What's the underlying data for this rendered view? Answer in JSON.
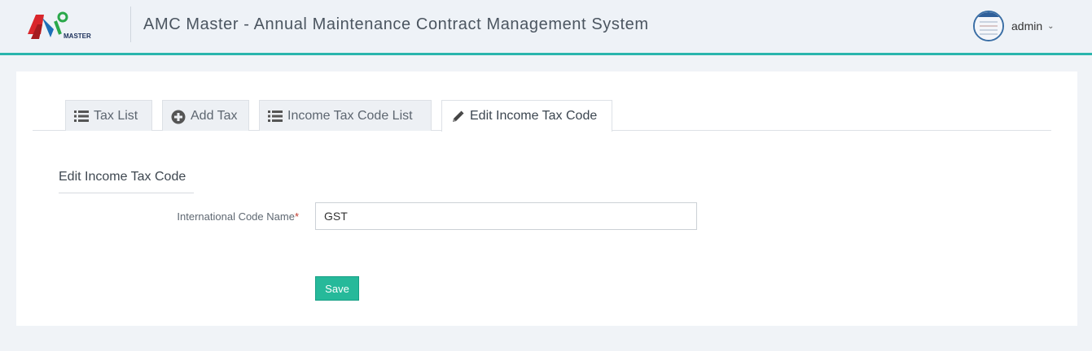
{
  "header": {
    "logo_text": "AMC",
    "logo_sub": "MASTER",
    "app_title": "AMC Master - Annual Maintenance Contract Management System",
    "user_name": "admin"
  },
  "tabs": [
    {
      "label": "Tax List",
      "icon": "list-icon"
    },
    {
      "label": "Add Tax",
      "icon": "plus-circle-icon"
    },
    {
      "label": "Income Tax Code List",
      "icon": "list-icon"
    },
    {
      "label": "Edit Income Tax Code",
      "icon": "pencil-icon",
      "active": true
    }
  ],
  "form": {
    "section_title": "Edit Income Tax Code",
    "code_name_label": "International Code Name",
    "required_mark": "*",
    "code_name_value": "GST",
    "save_label": "Save"
  },
  "colors": {
    "accent": "#2ab5ad",
    "save_button": "#26b99a",
    "required": "#c0392b"
  }
}
